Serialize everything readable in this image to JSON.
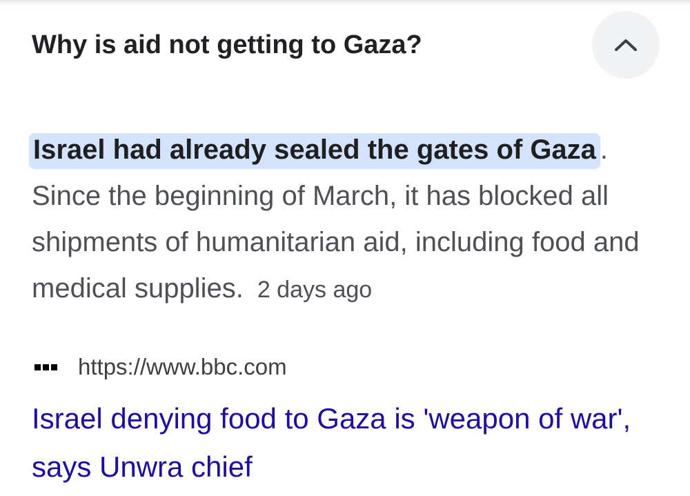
{
  "question": {
    "text": "Why is aid not getting to Gaza?",
    "toggle_icon": "chevron-up-icon"
  },
  "answer": {
    "highlighted": "Israel had already sealed the gates of Gaza",
    "punctuation": ".",
    "body": " Since the beginning of March, it has blocked all shipments of humanitarian aid, including food and medical supplies.",
    "timestamp": "2 days ago"
  },
  "source": {
    "favicon": "bbc-logo-icon",
    "url": "https://www.bbc.com",
    "title": "Israel denying food to Gaza is 'weapon of war', says Unwra chief"
  },
  "colors": {
    "highlight_bg": "#d3e3fd",
    "link": "#1a0dab",
    "button_bg": "#f1f3f4"
  }
}
